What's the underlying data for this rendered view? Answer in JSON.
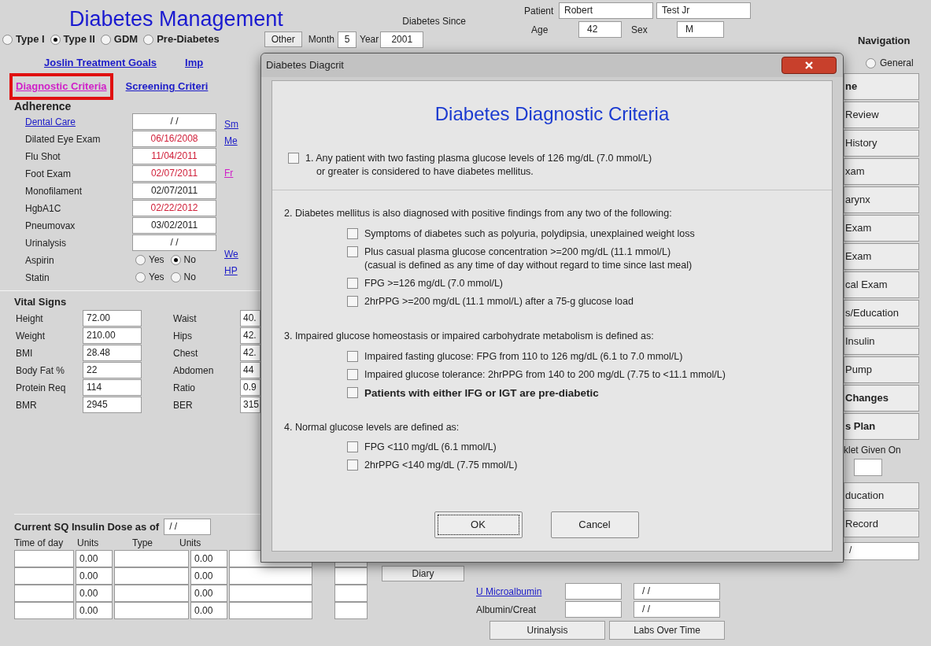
{
  "header": {
    "title": "Diabetes Management",
    "diabetes_types": [
      {
        "label": "Type I",
        "selected": false
      },
      {
        "label": "Type II",
        "selected": true
      },
      {
        "label": "GDM",
        "selected": false
      },
      {
        "label": "Pre-Diabetes",
        "selected": false
      }
    ],
    "other_button": "Other",
    "diabetes_since": {
      "label": "Diabetes Since",
      "month_label": "Month",
      "month": "5",
      "year_label": "Year",
      "year": "2001"
    },
    "patient": {
      "label": "Patient",
      "first_name": "Robert",
      "last_name": "Test Jr",
      "age_label": "Age",
      "age": "42",
      "sex_label": "Sex",
      "sex": "M"
    }
  },
  "top_links": [
    {
      "label": "Joslin Treatment Goals",
      "visited": false,
      "highlighted": false
    },
    {
      "label": "Imp",
      "visited": false,
      "highlighted": false
    }
  ],
  "criteria_links": [
    {
      "label": "Diagnostic Criteria",
      "visited": true,
      "highlighted": true
    },
    {
      "label": "Screening Criteri",
      "visited": false,
      "highlighted": false
    }
  ],
  "adherence": {
    "title": "Adherence",
    "rows": [
      {
        "label": "Dental Care",
        "kind": "date",
        "is_link": true,
        "value": "/ /",
        "overdue": false
      },
      {
        "label": "Dilated Eye Exam",
        "kind": "date",
        "is_link": false,
        "value": "06/16/2008",
        "overdue": true
      },
      {
        "label": "Flu Shot",
        "kind": "date",
        "is_link": false,
        "value": "11/04/2011",
        "overdue": true
      },
      {
        "label": "Foot Exam",
        "kind": "date",
        "is_link": false,
        "value": "02/07/2011",
        "overdue": true
      },
      {
        "label": "Monofilament",
        "kind": "date",
        "is_link": false,
        "value": "02/07/2011",
        "overdue": false
      },
      {
        "label": "HgbA1C",
        "kind": "date",
        "is_link": false,
        "value": "02/22/2012",
        "overdue": true
      },
      {
        "label": "Pneumovax",
        "kind": "date",
        "is_link": false,
        "value": "03/02/2011",
        "overdue": false
      },
      {
        "label": "Urinalysis",
        "kind": "date",
        "is_link": false,
        "value": "/ /",
        "overdue": false
      },
      {
        "label": "Aspirin",
        "kind": "yes_no",
        "is_link": false,
        "options": [
          {
            "label": "Yes",
            "selected": false
          },
          {
            "label": "No",
            "selected": true
          }
        ]
      },
      {
        "label": "Statin",
        "kind": "yes_no",
        "is_link": false,
        "options": [
          {
            "label": "Yes",
            "selected": false
          },
          {
            "label": "No",
            "selected": false
          }
        ]
      }
    ]
  },
  "side_links": [
    {
      "label": "Sm",
      "visited": false
    },
    {
      "label": "Me",
      "visited": false
    },
    {
      "label": "Fr",
      "visited": true
    },
    {
      "label": "We",
      "visited": false
    },
    {
      "label": "HP",
      "visited": false
    }
  ],
  "vital_signs": {
    "title": "Vital Signs",
    "left": [
      {
        "label": "Height",
        "value": "72.00"
      },
      {
        "label": "Weight",
        "value": "210.00"
      },
      {
        "label": "BMI",
        "value": "28.48"
      },
      {
        "label": "Body Fat %",
        "value": "22"
      },
      {
        "label": "Protein Req",
        "value": "114"
      },
      {
        "label": "BMR",
        "value": "2945"
      }
    ],
    "right": [
      {
        "label": "Waist",
        "value": "40."
      },
      {
        "label": "Hips",
        "value": "42."
      },
      {
        "label": "Chest",
        "value": "42."
      },
      {
        "label": "Abdomen",
        "value": "44"
      },
      {
        "label": "Ratio",
        "value": "0.9"
      },
      {
        "label": "BER",
        "value": "315"
      }
    ]
  },
  "insulin": {
    "title": "Current SQ Insulin Dose as of",
    "date": "/ /",
    "columns": [
      "Time of day",
      "Units",
      "Type",
      "Units"
    ],
    "rows": [
      {
        "units_1": "0.00",
        "units_2": "0.00"
      },
      {
        "units_1": "0.00",
        "units_2": "0.00"
      },
      {
        "units_1": "0.00",
        "units_2": "0.00"
      },
      {
        "units_1": "0.00",
        "units_2": "0.00"
      }
    ]
  },
  "labs": {
    "diary_button": "Diary",
    "rows": [
      {
        "label": "U Microalbumin",
        "is_link": true,
        "date": "/ /"
      },
      {
        "label": "Albumin/Creat",
        "is_link": false,
        "date": "/ /"
      }
    ],
    "buttons": [
      "Urinalysis",
      "Labs Over Time"
    ]
  },
  "navigation": {
    "title": "Navigation",
    "general": {
      "label": "General",
      "selected": false
    },
    "items": [
      {
        "kind": "button",
        "label": "ne",
        "bold": true
      },
      {
        "kind": "button",
        "label": "Review",
        "bold": false
      },
      {
        "kind": "button",
        "label": "History",
        "bold": false
      },
      {
        "kind": "button",
        "label": "xam",
        "bold": false
      },
      {
        "kind": "button",
        "label": "arynx",
        "bold": false
      },
      {
        "kind": "button",
        "label": "Exam",
        "bold": false
      },
      {
        "kind": "button",
        "label": "Exam",
        "bold": false
      },
      {
        "kind": "button",
        "label": "cal Exam",
        "bold": false
      },
      {
        "kind": "button",
        "label": "s/Education",
        "bold": false
      },
      {
        "kind": "button",
        "label": "Insulin",
        "bold": false
      },
      {
        "kind": "button",
        "label": "Pump",
        "bold": false
      },
      {
        "kind": "button",
        "label": "Changes",
        "bold": true
      },
      {
        "kind": "button",
        "label": "s Plan",
        "bold": true
      },
      {
        "kind": "text",
        "label": "klet Given On"
      },
      {
        "kind": "small_field"
      },
      {
        "kind": "button",
        "label": "ducation",
        "bold": false
      },
      {
        "kind": "button",
        "label": "Record",
        "bold": false
      },
      {
        "kind": "field",
        "label": "/"
      }
    ]
  },
  "dialog": {
    "title": "Diabetes Diagcrit",
    "heading": "Diabetes Diagnostic Criteria",
    "sections": [
      {
        "kind": "checkbox",
        "checked": false,
        "lines": [
          "1. Any patient with two fasting plasma glucose levels of 126 mg/dL (7.0 mmol/L)",
          "or greater is considered to have diabetes mellitus."
        ]
      },
      {
        "kind": "group",
        "heading": "2.  Diabetes mellitus is also diagnosed with positive findings from any two of the following:",
        "items": [
          {
            "checked": false,
            "bold": false,
            "lines": [
              "Symptoms of diabetes such as polyuria, polydipsia, unexplained weight loss"
            ]
          },
          {
            "checked": false,
            "bold": false,
            "lines": [
              "Plus casual plasma glucose concentration >=200 mg/dL (11.1 mmol/L)",
              "(casual is defined as any time of day without regard to time since last meal)"
            ]
          },
          {
            "checked": false,
            "bold": false,
            "lines": [
              "FPG >=126 mg/dL (7.0 mmol/L)"
            ]
          },
          {
            "checked": false,
            "bold": false,
            "lines": [
              "2hrPPG >=200 mg/dL (11.1 mmol/L) after a 75-g glucose load"
            ]
          }
        ]
      },
      {
        "kind": "group",
        "heading": "3.  Impaired glucose homeostasis or impaired carbohydrate metabolism is defined as:",
        "items": [
          {
            "checked": false,
            "bold": false,
            "lines": [
              "Impaired fasting glucose: FPG from 110 to 126 mg/dL (6.1 to 7.0 mmol/L)"
            ]
          },
          {
            "checked": false,
            "bold": false,
            "lines": [
              "Impaired glucose tolerance: 2hrPPG from 140 to 200 mg/dL (7.75 to <11.1 mmol/L)"
            ]
          },
          {
            "checked": false,
            "bold": true,
            "lines": [
              "Patients with either IFG or IGT are pre-diabetic"
            ]
          }
        ]
      },
      {
        "kind": "group",
        "heading": "4. Normal glucose levels are defined as:",
        "items": [
          {
            "checked": false,
            "bold": false,
            "lines": [
              "FPG <110 mg/dL (6.1 mmol/L)"
            ]
          },
          {
            "checked": false,
            "bold": false,
            "lines": [
              "2hrPPG <140 mg/dL (7.75 mmol/L)"
            ]
          }
        ]
      }
    ],
    "buttons": [
      {
        "label": "OK",
        "focused": true
      },
      {
        "label": "Cancel",
        "focused": false
      }
    ]
  }
}
